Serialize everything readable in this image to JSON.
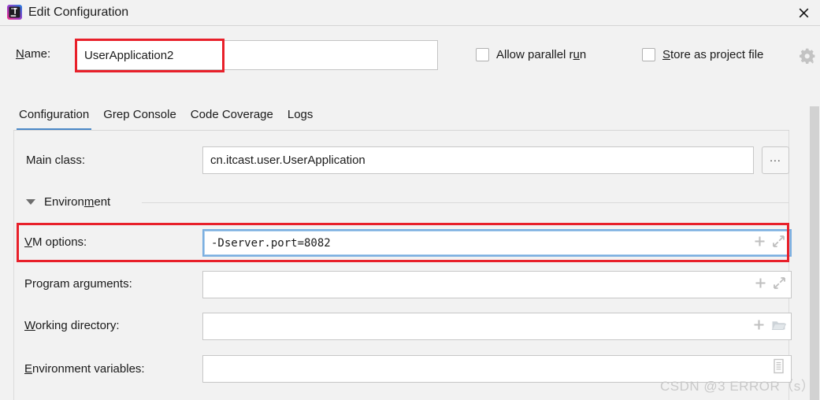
{
  "window": {
    "title": "Edit Configuration",
    "logo_icon": "intellij-idea-logo",
    "close_icon": "close-icon"
  },
  "name_row": {
    "label_prefix": "N",
    "label_rest": "ame:",
    "value": "UserApplication2",
    "placeholder": "",
    "highlight_color": "#e8202a"
  },
  "options": {
    "allow_parallel": {
      "label_prefix": "Allow parallel r",
      "label_accel": "u",
      "label_suffix": "n",
      "checked": false
    },
    "store_as_project_file": {
      "label_accel": "S",
      "label_rest": "tore as project file",
      "checked": false
    },
    "gear_icon": "gear-icon"
  },
  "tabs": [
    {
      "label": "Configuration",
      "active": true
    },
    {
      "label": "Grep Console",
      "active": false
    },
    {
      "label": "Code Coverage",
      "active": false
    },
    {
      "label": "Logs",
      "active": false
    }
  ],
  "tab_accent_color": "#4a88c7",
  "fields": {
    "main_class": {
      "label": "Main class:",
      "value": "cn.itcast.user.UserApplication",
      "placeholder": "",
      "browse_label": "...",
      "browse_icon": "ellipsis-browse-icon"
    },
    "environment_section": {
      "title_prefix": "Environ",
      "title_accel": "m",
      "title_suffix": "ent",
      "expanded": true,
      "collapse_icon": "triangle-down-icon"
    },
    "vm_options": {
      "label_accel": "V",
      "label_rest": "M options:",
      "value": "-Dserver.port=8082",
      "placeholder": "",
      "focused": true,
      "icons": [
        "plus-icon",
        "expand-diagonal-icon"
      ],
      "highlight_color": "#e8202a"
    },
    "program_arguments": {
      "label_prefix": "Program ar",
      "label_accel": "g",
      "label_suffix": "uments:",
      "value": "",
      "placeholder": "",
      "icons": [
        "plus-icon",
        "expand-diagonal-icon"
      ]
    },
    "working_directory": {
      "label_accel": "W",
      "label_rest": "orking directory:",
      "value": "",
      "placeholder": "",
      "icons": [
        "plus-icon",
        "folder-icon"
      ]
    },
    "environment_variables": {
      "label_accel": "E",
      "label_rest": "nvironment variables:",
      "value": "",
      "placeholder": "",
      "icons": [
        "list-browse-icon"
      ]
    }
  },
  "scrollbar": {
    "thumb_color": "#d2d2d2"
  },
  "watermark": {
    "text": "CSDN @3 ERROR（s）"
  }
}
